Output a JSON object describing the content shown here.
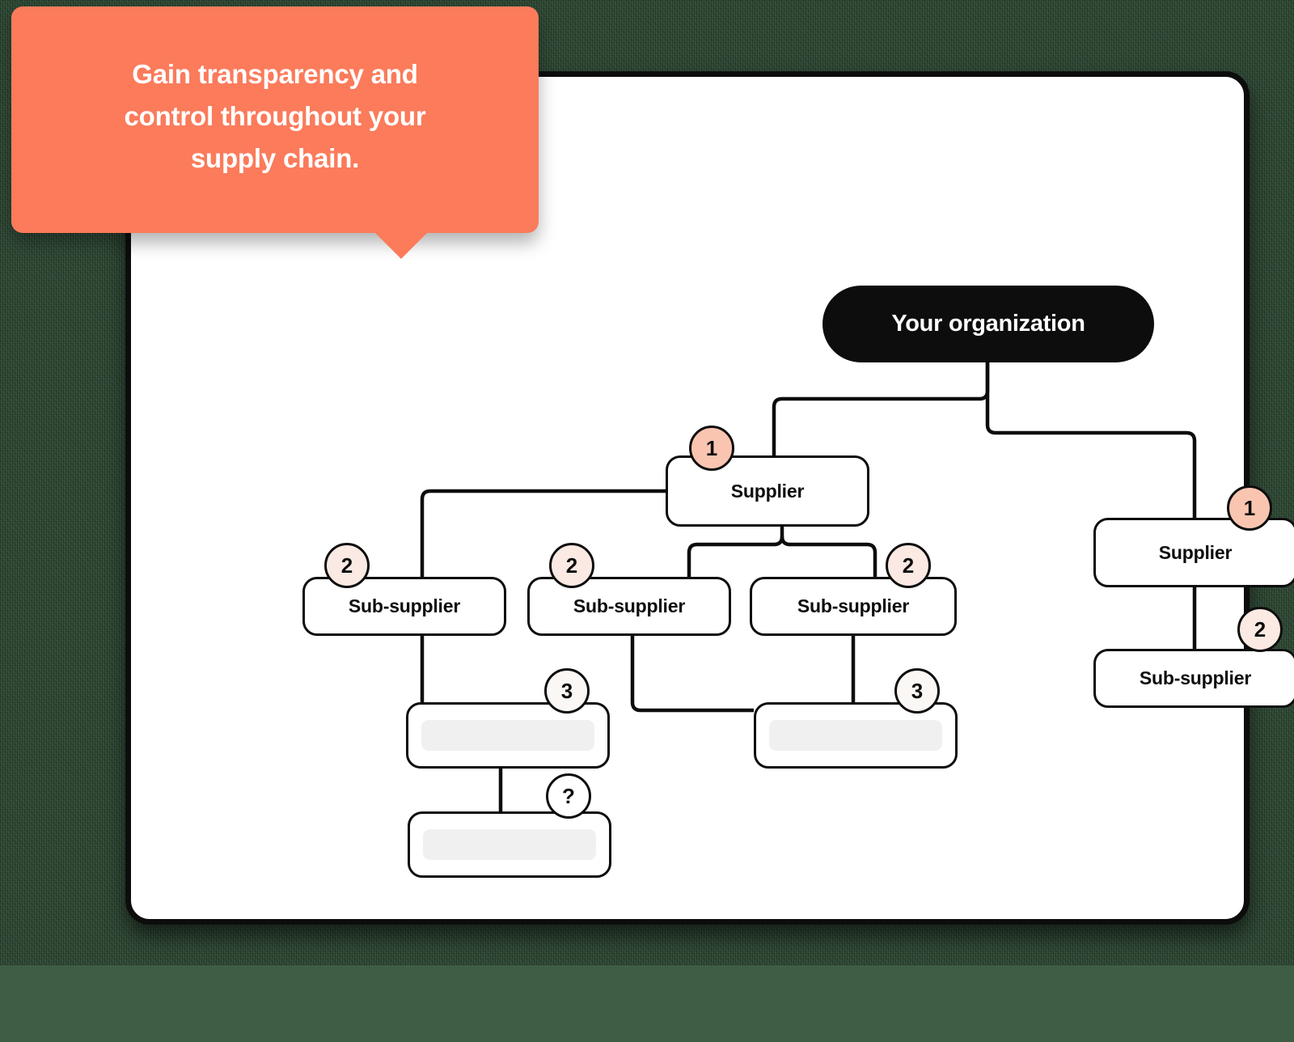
{
  "callout": {
    "text": "Gain transparency and\ncontrol throughout your\nsupply chain.",
    "color": "#fb7b5b",
    "text_color": "#ffffff"
  },
  "card": {
    "background": "#ffffff",
    "border_color": "#0d0d0d"
  },
  "page": {
    "background": "#3e5d45"
  },
  "diagram": {
    "type": "hierarchy-tree",
    "root": {
      "label": "Your organization",
      "background": "#0d0d0d",
      "text_color": "#ffffff"
    },
    "tier_colors": {
      "1": "#fac5b0",
      "2": "#fbe9e3",
      "3": "#fbf7f5",
      "unknown": "#ffffff"
    },
    "nodes": [
      {
        "id": "org",
        "label": "Your organization",
        "badge": "",
        "tier": "root"
      },
      {
        "id": "sup-left",
        "label": "Supplier",
        "badge": "1",
        "tier": "1"
      },
      {
        "id": "sup-right",
        "label": "Supplier",
        "badge": "1",
        "tier": "1"
      },
      {
        "id": "sub-a",
        "label": "Sub-supplier",
        "badge": "2",
        "tier": "2"
      },
      {
        "id": "sub-b",
        "label": "Sub-supplier",
        "badge": "2",
        "tier": "2"
      },
      {
        "id": "sub-c",
        "label": "Sub-supplier",
        "badge": "2",
        "tier": "2"
      },
      {
        "id": "sub-right",
        "label": "Sub-supplier",
        "badge": "2",
        "tier": "2"
      },
      {
        "id": "blank-1",
        "label": "",
        "badge": "3",
        "tier": "3"
      },
      {
        "id": "blank-2",
        "label": "",
        "badge": "3",
        "tier": "3"
      },
      {
        "id": "blank-3",
        "label": "",
        "badge": "?",
        "tier": "unknown"
      }
    ],
    "edges": [
      {
        "from": "org",
        "to": "sup-left"
      },
      {
        "from": "org",
        "to": "sup-right"
      },
      {
        "from": "sup-left",
        "to": "sub-a"
      },
      {
        "from": "sup-left",
        "to": "sub-b"
      },
      {
        "from": "sup-left",
        "to": "sub-c"
      },
      {
        "from": "sup-right",
        "to": "sub-right"
      },
      {
        "from": "sub-a",
        "to": "blank-1"
      },
      {
        "from": "sub-b",
        "to": "blank-2"
      },
      {
        "from": "sub-c",
        "to": "blank-2"
      },
      {
        "from": "blank-1",
        "to": "blank-3"
      }
    ]
  }
}
